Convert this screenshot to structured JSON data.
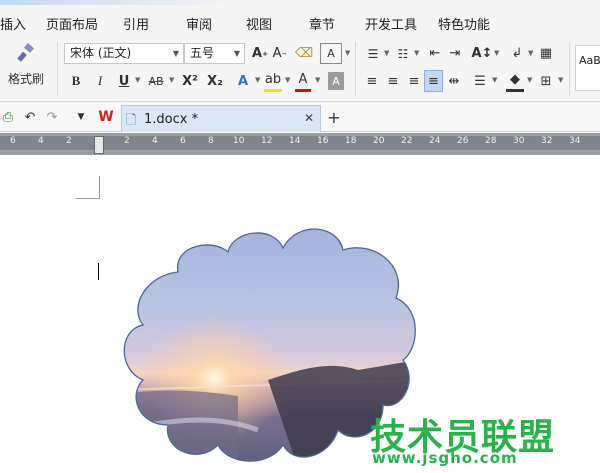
{
  "menu": {
    "items": [
      "插入",
      "页面布局",
      "引用",
      "审阅",
      "视图",
      "章节",
      "开发工具",
      "特色功能"
    ]
  },
  "ribbon": {
    "format_painter": "格式刷",
    "font_name": "宋体 (正文)",
    "font_size": "五号",
    "bold": "B",
    "italic": "I",
    "underline": "U",
    "strike": "AB",
    "superscript": "X²",
    "subscript": "X₂",
    "style_preview": "AaBb"
  },
  "tabs": {
    "doc_name": "1.docx *"
  },
  "ruler": {
    "ticks": [
      "6",
      "4",
      "2",
      "2",
      "4",
      "6",
      "8",
      "10",
      "12",
      "14",
      "16",
      "18",
      "20",
      "22",
      "24",
      "26",
      "28",
      "30",
      "32",
      "34"
    ]
  },
  "watermark": {
    "title": "技术员联盟",
    "url": "www.jsgho.com"
  },
  "colors": {
    "accent": "#dbe6f6",
    "watermark": "#27b34a"
  }
}
